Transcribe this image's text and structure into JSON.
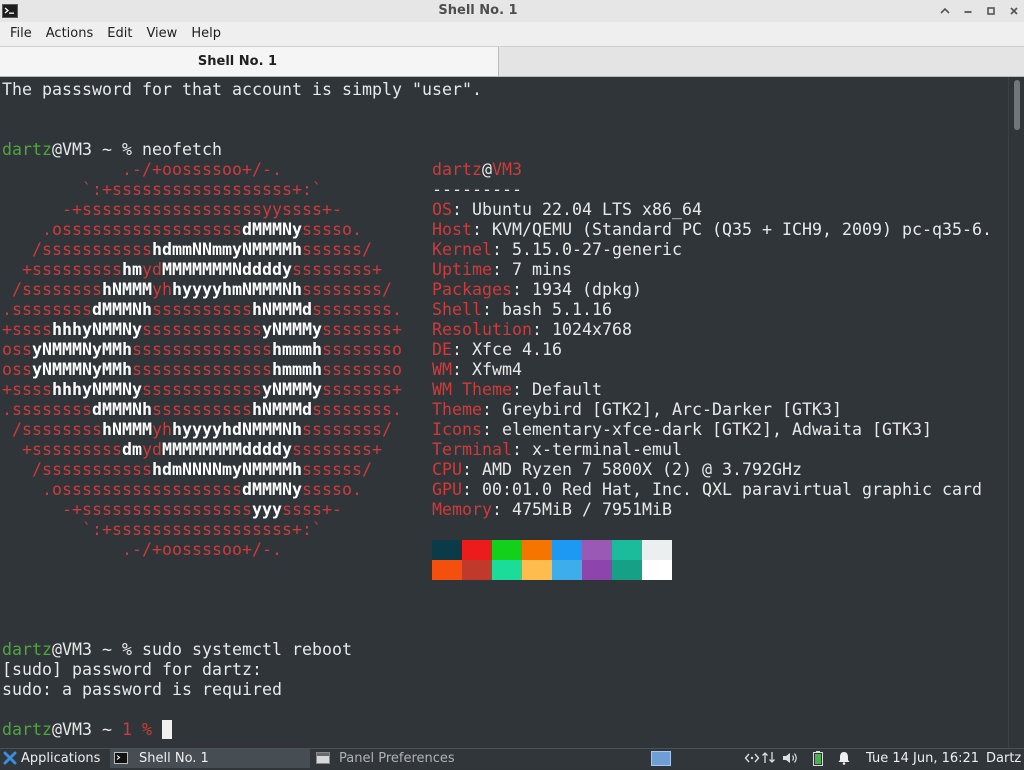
{
  "window": {
    "title": "Shell No. 1",
    "app_icon": "terminal-icon",
    "controls": [
      "shade-icon",
      "minimize-icon",
      "maximize-icon",
      "close-icon"
    ]
  },
  "menu": [
    "File",
    "Actions",
    "Edit",
    "View",
    "Help"
  ],
  "tabs": [
    {
      "label": "Shell No. 1",
      "active": true
    }
  ],
  "terminal": {
    "colors": {
      "bg": "#2f3538",
      "fg": "#e8e8e8",
      "red": "#d03a3a",
      "white": "#ffffff",
      "green": "#4ea63d",
      "cursor": "#f0f0f0"
    },
    "lines_before": [
      [
        {
          "c": "fg",
          "t": "The passsword for that account is simply \"user\"."
        }
      ],
      [],
      [],
      [
        {
          "c": "green",
          "t": "dartz"
        },
        {
          "c": "fg",
          "t": "@VM3 ~ % neofetch"
        }
      ]
    ],
    "neofetch": {
      "logo": [
        [
          {
            "c": "red",
            "t": "            .-/+oossssoo+/-."
          }
        ],
        [
          {
            "c": "red",
            "t": "        `:+ssssssssssssssssss+:`"
          }
        ],
        [
          {
            "c": "red",
            "t": "      -+ssssssssssssssssssyyssss+-"
          }
        ],
        [
          {
            "c": "red",
            "t": "    .ossssssssssssssssss"
          },
          {
            "c": "white",
            "t": "dMMMNy"
          },
          {
            "c": "red",
            "t": "sssso."
          }
        ],
        [
          {
            "c": "red",
            "t": "   /sssssssssss"
          },
          {
            "c": "white",
            "t": "hdmmNNmmyNMMMMh"
          },
          {
            "c": "red",
            "t": "ssssss/"
          }
        ],
        [
          {
            "c": "red",
            "t": "  +sssssssss"
          },
          {
            "c": "white",
            "t": "hm"
          },
          {
            "c": "red",
            "t": "yd"
          },
          {
            "c": "white",
            "t": "MMMMMMMNddddy"
          },
          {
            "c": "red",
            "t": "ssssssss+"
          }
        ],
        [
          {
            "c": "red",
            "t": " /ssssssss"
          },
          {
            "c": "white",
            "t": "hNMMM"
          },
          {
            "c": "red",
            "t": "yh"
          },
          {
            "c": "white",
            "t": "hyyyyhmNMMMNh"
          },
          {
            "c": "red",
            "t": "ssssssss/"
          }
        ],
        [
          {
            "c": "red",
            "t": ".ssssssss"
          },
          {
            "c": "white",
            "t": "dMMMNh"
          },
          {
            "c": "red",
            "t": "ssssssssss"
          },
          {
            "c": "white",
            "t": "hNMMMd"
          },
          {
            "c": "red",
            "t": "ssssssss."
          }
        ],
        [
          {
            "c": "red",
            "t": "+ssss"
          },
          {
            "c": "white",
            "t": "hhhyNMMNy"
          },
          {
            "c": "red",
            "t": "ssssssssssss"
          },
          {
            "c": "white",
            "t": "yNMMMy"
          },
          {
            "c": "red",
            "t": "sssssss+"
          }
        ],
        [
          {
            "c": "red",
            "t": "oss"
          },
          {
            "c": "white",
            "t": "yNMMMNyMMh"
          },
          {
            "c": "red",
            "t": "ssssssssssssss"
          },
          {
            "c": "white",
            "t": "hmmmh"
          },
          {
            "c": "red",
            "t": "ssssssso"
          }
        ],
        [
          {
            "c": "red",
            "t": "oss"
          },
          {
            "c": "white",
            "t": "yNMMMNyMMh"
          },
          {
            "c": "red",
            "t": "ssssssssssssss"
          },
          {
            "c": "white",
            "t": "hmmmh"
          },
          {
            "c": "red",
            "t": "ssssssso"
          }
        ],
        [
          {
            "c": "red",
            "t": "+ssss"
          },
          {
            "c": "white",
            "t": "hhhyNMMNy"
          },
          {
            "c": "red",
            "t": "ssssssssssss"
          },
          {
            "c": "white",
            "t": "yNMMMy"
          },
          {
            "c": "red",
            "t": "sssssss+"
          }
        ],
        [
          {
            "c": "red",
            "t": ".ssssssss"
          },
          {
            "c": "white",
            "t": "dMMMNh"
          },
          {
            "c": "red",
            "t": "ssssssssss"
          },
          {
            "c": "white",
            "t": "hNMMMd"
          },
          {
            "c": "red",
            "t": "ssssssss."
          }
        ],
        [
          {
            "c": "red",
            "t": " /ssssssss"
          },
          {
            "c": "white",
            "t": "hNMMM"
          },
          {
            "c": "red",
            "t": "yh"
          },
          {
            "c": "white",
            "t": "hyyyyhdNMMMNh"
          },
          {
            "c": "red",
            "t": "ssssssss/"
          }
        ],
        [
          {
            "c": "red",
            "t": "  +sssssssss"
          },
          {
            "c": "white",
            "t": "dm"
          },
          {
            "c": "red",
            "t": "yd"
          },
          {
            "c": "white",
            "t": "MMMMMMMMddddy"
          },
          {
            "c": "red",
            "t": "ssssssss+"
          }
        ],
        [
          {
            "c": "red",
            "t": "   /sssssssssss"
          },
          {
            "c": "white",
            "t": "hdmNNNNmyNMMMMh"
          },
          {
            "c": "red",
            "t": "ssssss/"
          }
        ],
        [
          {
            "c": "red",
            "t": "    .ossssssssssssssssss"
          },
          {
            "c": "white",
            "t": "dMMMNy"
          },
          {
            "c": "red",
            "t": "sssso."
          }
        ],
        [
          {
            "c": "red",
            "t": "      -+sssssssssssssssss"
          },
          {
            "c": "white",
            "t": "yyy"
          },
          {
            "c": "red",
            "t": "ssss+-"
          }
        ],
        [
          {
            "c": "red",
            "t": "        `:+ssssssssssssssssss+:`"
          }
        ],
        [
          {
            "c": "red",
            "t": "            .-/+oossssoo+/-."
          }
        ]
      ],
      "info": [
        [
          {
            "c": "red",
            "t": "dartz"
          },
          {
            "c": "fg",
            "t": "@"
          },
          {
            "c": "red",
            "t": "VM3"
          }
        ],
        [
          {
            "c": "fg",
            "t": "---------"
          }
        ],
        [
          {
            "c": "red",
            "t": "OS"
          },
          {
            "c": "fg",
            "t": ": Ubuntu 22.04 LTS x86_64"
          }
        ],
        [
          {
            "c": "red",
            "t": "Host"
          },
          {
            "c": "fg",
            "t": ": KVM/QEMU (Standard PC (Q35 + ICH9, 2009) pc-q35-6."
          }
        ],
        [
          {
            "c": "red",
            "t": "Kernel"
          },
          {
            "c": "fg",
            "t": ": 5.15.0-27-generic"
          }
        ],
        [
          {
            "c": "red",
            "t": "Uptime"
          },
          {
            "c": "fg",
            "t": ": 7 mins"
          }
        ],
        [
          {
            "c": "red",
            "t": "Packages"
          },
          {
            "c": "fg",
            "t": ": 1934 (dpkg)"
          }
        ],
        [
          {
            "c": "red",
            "t": "Shell"
          },
          {
            "c": "fg",
            "t": ": bash 5.1.16"
          }
        ],
        [
          {
            "c": "red",
            "t": "Resolution"
          },
          {
            "c": "fg",
            "t": ": 1024x768"
          }
        ],
        [
          {
            "c": "red",
            "t": "DE"
          },
          {
            "c": "fg",
            "t": ": Xfce 4.16"
          }
        ],
        [
          {
            "c": "red",
            "t": "WM"
          },
          {
            "c": "fg",
            "t": ": Xfwm4"
          }
        ],
        [
          {
            "c": "red",
            "t": "WM Theme"
          },
          {
            "c": "fg",
            "t": ": Default"
          }
        ],
        [
          {
            "c": "red",
            "t": "Theme"
          },
          {
            "c": "fg",
            "t": ": Greybird [GTK2], Arc-Darker [GTK3]"
          }
        ],
        [
          {
            "c": "red",
            "t": "Icons"
          },
          {
            "c": "fg",
            "t": ": elementary-xfce-dark [GTK2], Adwaita [GTK3]"
          }
        ],
        [
          {
            "c": "red",
            "t": "Terminal"
          },
          {
            "c": "fg",
            "t": ": x-terminal-emul"
          }
        ],
        [
          {
            "c": "red",
            "t": "CPU"
          },
          {
            "c": "fg",
            "t": ": AMD Ryzen 7 5800X (2) @ 3.792GHz"
          }
        ],
        [
          {
            "c": "red",
            "t": "GPU"
          },
          {
            "c": "fg",
            "t": ": 00:01.0 Red Hat, Inc. QXL paravirtual graphic card"
          }
        ],
        [
          {
            "c": "red",
            "t": "Memory"
          },
          {
            "c": "fg",
            "t": ": 475MiB / 7951MiB"
          }
        ]
      ],
      "palette": [
        [
          "#0b3a48",
          "#ec1c1c",
          "#13d01a",
          "#f67400",
          "#1d99f3",
          "#9b59b6",
          "#1abc9c",
          "#eceff0"
        ],
        [
          "#f4500d",
          "#c0392b",
          "#1cdc9a",
          "#fdbc4b",
          "#3daee9",
          "#8e44ad",
          "#16a085",
          "#ffffff"
        ]
      ]
    },
    "lines_after": [
      [],
      [],
      [],
      [
        {
          "c": "green",
          "t": "dartz"
        },
        {
          "c": "fg",
          "t": "@VM3 ~ % sudo systemctl reboot"
        }
      ],
      [
        {
          "c": "fg",
          "t": "[sudo] password for dartz:"
        }
      ],
      [
        {
          "c": "fg",
          "t": "sudo: a password is required"
        }
      ],
      [],
      [
        {
          "c": "green",
          "t": "dartz"
        },
        {
          "c": "fg",
          "t": "@VM3 ~ "
        },
        {
          "c": "red",
          "t": "1 %"
        },
        {
          "c": "fg",
          "t": " "
        },
        {
          "c": "cursor",
          "t": " "
        }
      ]
    ]
  },
  "taskbar": {
    "apps_icon": "xfce-menu-icon",
    "apps_label": "Applications",
    "tasks": [
      {
        "label": "Shell No. 1",
        "icon": "terminal-icon",
        "active": true
      },
      {
        "label": "Panel Preferences",
        "icon": "panel-preferences-icon",
        "active": false
      }
    ],
    "tray_icons": [
      "workspace-switcher",
      "network-icon",
      "transfer-arrows-icon",
      "volume-icon",
      "battery-icon",
      "notification-bell-icon"
    ],
    "clock": "Tue 14 Jun, 16:21",
    "user": "Dartz"
  }
}
